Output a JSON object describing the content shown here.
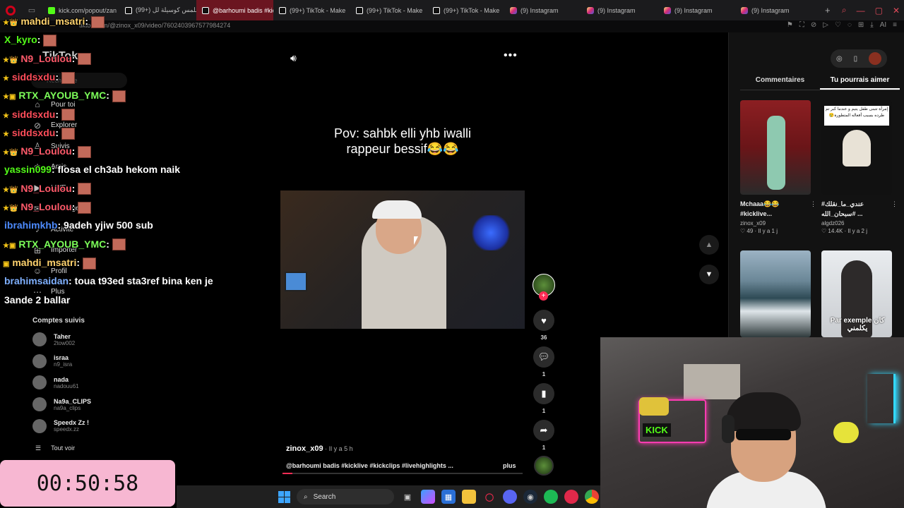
{
  "browser": {
    "tabs": [
      {
        "label": "kick.com/popout/zan",
        "icon": "kick-icon",
        "active": false
      },
      {
        "label": "(99+) اللمس كوسيلة لل",
        "icon": "tiktok-icon",
        "active": false
      },
      {
        "label": "@barhoumi badis #kic",
        "icon": "tiktok-icon",
        "active": true
      },
      {
        "label": "(99+) TikTok - Make",
        "icon": "tiktok-icon",
        "active": false
      },
      {
        "label": "(99+) TikTok - Make",
        "icon": "tiktok-icon",
        "active": false
      },
      {
        "label": "(99+) TikTok - Make",
        "icon": "tiktok-icon",
        "active": false
      },
      {
        "label": "(9) Instagram",
        "icon": "instagram-icon",
        "active": false
      },
      {
        "label": "(9) Instagram",
        "icon": "instagram-icon",
        "active": false
      },
      {
        "label": "(9) Instagram",
        "icon": "instagram-icon",
        "active": false
      },
      {
        "label": "(9) Instagram",
        "icon": "instagram-icon",
        "active": false
      }
    ],
    "new_tab": "+",
    "url": "tiktok.com/@zinox_x09/video/7602403967577984274",
    "ai_label": "AI"
  },
  "sidebar": {
    "logo": "TikTok",
    "search_placeholder": "Recherche",
    "nav": [
      {
        "label": "Pour toi",
        "icon": "home-icon"
      },
      {
        "label": "Explorer",
        "icon": "compass-icon"
      },
      {
        "label": "Suivis",
        "icon": "following-icon"
      },
      {
        "label": "Amis",
        "icon": "friends-icon"
      },
      {
        "label": "LIVE",
        "icon": "live-icon"
      },
      {
        "label": "Messages",
        "icon": "message-icon"
      },
      {
        "label": "Activité",
        "icon": "bell-icon"
      },
      {
        "label": "Importer",
        "icon": "upload-icon"
      },
      {
        "label": "Profil",
        "icon": "profile-icon"
      },
      {
        "label": "Plus",
        "icon": "more-icon"
      }
    ],
    "following_title": "Comptes suivis",
    "following": [
      {
        "name": "Taher",
        "handle": "2tow002"
      },
      {
        "name": "israa",
        "handle": "n9_isra"
      },
      {
        "name": "nada",
        "handle": "nadouu61"
      },
      {
        "name": "Na9a_CLIPS",
        "handle": "na9a_clips"
      },
      {
        "name": "Speedx Zz !",
        "handle": "speedx.zz"
      }
    ],
    "see_all": "Tout voir"
  },
  "chat": [
    {
      "user": "mahdi_msatri",
      "text": ":",
      "color": "#ffd36e",
      "emote": true,
      "badges": "★👑"
    },
    {
      "user": "X_kyro",
      "text": ":",
      "color": "#53fc18",
      "emote": true,
      "badges": ""
    },
    {
      "user": "N9_Loulou",
      "text": ":",
      "color": "#ff5a6a",
      "emote": true,
      "badges": "★👑"
    },
    {
      "user": "siddsxdu",
      "text": ":",
      "color": "#ff4d5a",
      "emote": true,
      "badges": "★"
    },
    {
      "user": "RTX_AYOUB_YMC",
      "text": ":",
      "color": "#7dff5a",
      "emote": true,
      "badges": "★▣"
    },
    {
      "user": "siddsxdu",
      "text": ":",
      "color": "#ff4d5a",
      "emote": true,
      "badges": "★"
    },
    {
      "user": "siddsxdu",
      "text": ":",
      "color": "#ff4d5a",
      "emote": true,
      "badges": "★"
    },
    {
      "user": "N9_Loulou",
      "text": ":",
      "color": "#ff5a6a",
      "emote": true,
      "badges": "★👑"
    },
    {
      "user": "yassin099",
      "text": ": flosa el ch3ab hekom naik",
      "color": "#53fc18",
      "emote": false,
      "badges": ""
    },
    {
      "user": "N9_Loulou",
      "text": ":",
      "color": "#ff5a6a",
      "emote": true,
      "badges": "★👑"
    },
    {
      "user": "N9_Loulou",
      "text": ":",
      "color": "#ff5a6a",
      "emote": true,
      "badges": "★👑"
    },
    {
      "user": "ibrahimkhb",
      "text": ": 9adeh yjiw 500 sub",
      "color": "#4d8bff",
      "emote": false,
      "badges": ""
    },
    {
      "user": "RTX_AYOUB_YMC",
      "text": ":",
      "color": "#7dff5a",
      "emote": true,
      "badges": "★▣"
    },
    {
      "user": "mahdi_msatri",
      "text": ":",
      "color": "#ffd36e",
      "emote": true,
      "badges": "▣"
    },
    {
      "user": "brahimsaidan",
      "text": ": toua t93ed sta3ref bina ken je",
      "color": "#7fb0ff",
      "emote": false,
      "badges": ""
    },
    {
      "user": "",
      "text": "3ande 2 ballar",
      "color": "#ffffff",
      "emote": false,
      "badges": ""
    }
  ],
  "video": {
    "caption_line1": "Pov: sahbk elli yhb iwalli",
    "caption_line2": "rappeur bessif😂😂",
    "author": "zinox_x09",
    "time": " · Il y a 5 h",
    "description": "@barhoumi badis #kicklive #kickclips #livehighlights ...",
    "more": "plus",
    "progress": 0.04,
    "likes": "36",
    "comments": "1",
    "saves": "1",
    "shares": "1",
    "follow_plus": "+"
  },
  "right_panel": {
    "tab_comments": "Commentaires",
    "tab_suggested": "Tu pourrais aimer",
    "cards": [
      {
        "title": "Mchaaa😂😂 #kicklive...",
        "user": "zinox_x09",
        "meta": "♡ 49 · Il y a 1 j"
      },
      {
        "title": "#عندي_ما_نقلك سبحان_الله# ...",
        "user": "algdz026",
        "meta": "♡ 14.4K · Il y a 2 j",
        "thumb_text": "إمرأة تتبنى طفل يتيم و عندما كبر تم طرده بسبب أفعاله المتطورة😢"
      },
      {
        "title": "",
        "user": "",
        "meta": ""
      },
      {
        "title": "",
        "user": "",
        "meta": "",
        "thumb_text": "Par exemple كان يكلمني"
      }
    ]
  },
  "webcam": {
    "sign": "KICK"
  },
  "timer": "00:50:58",
  "taskbar": {
    "search": "Search"
  },
  "colors": {
    "tiktok_red": "#fe2c55",
    "kick_green": "#53fc18",
    "timer_bg": "#f7b7d2",
    "active_tab": "#6b1520"
  }
}
